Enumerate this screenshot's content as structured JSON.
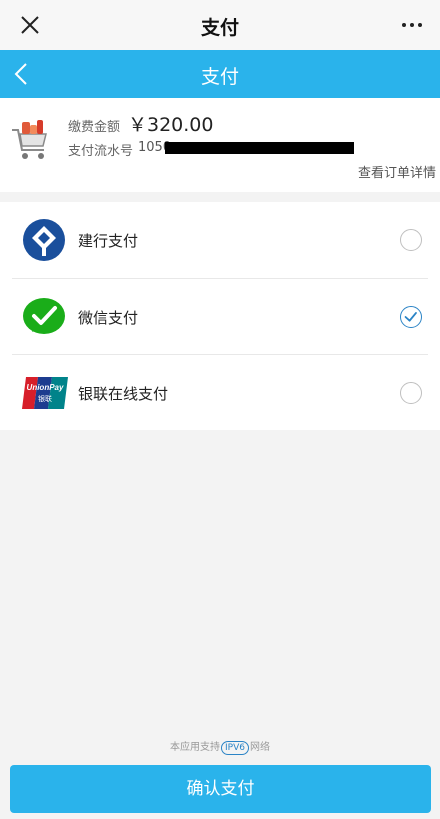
{
  "wechat_bar": {
    "title": "支付"
  },
  "header": {
    "title": "支付"
  },
  "order": {
    "amount_label": "缴费金额",
    "amount_value": "￥320.00",
    "serial_label": "支付流水号",
    "serial_prefix": "1050",
    "detail_link": "查看订单详情"
  },
  "payment_methods": [
    {
      "label": "建行支付",
      "selected": false
    },
    {
      "label": "微信支付",
      "selected": true
    },
    {
      "label": "银联在线支付",
      "selected": false
    }
  ],
  "footer": {
    "ipv6_prefix": "本应用支持",
    "ipv6_badge": "IPV6",
    "ipv6_suffix": "网络",
    "confirm_label": "确认支付"
  },
  "colors": {
    "accent": "#2ab3eb",
    "radio_checked": "#2b84c6"
  }
}
